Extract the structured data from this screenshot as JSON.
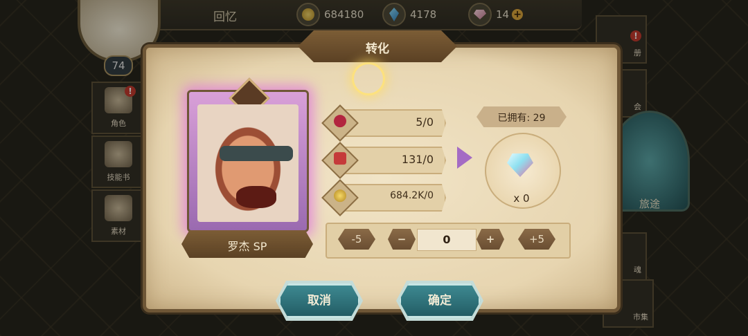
{
  "top_bar": {
    "title": "回忆",
    "coins": "684180",
    "crystals": "4178",
    "gems": "14"
  },
  "player": {
    "level": "74"
  },
  "left_menu": [
    {
      "label": "角色",
      "icon": "character-icon",
      "alert": "!"
    },
    {
      "label": "技能书",
      "icon": "skill-book-icon"
    },
    {
      "label": "素材",
      "icon": "material-icon"
    }
  ],
  "right_menu": {
    "top_partial": "册",
    "second_partial": "会",
    "journey": "旅途",
    "fourth_partial": "魂",
    "market": "市集"
  },
  "dialog": {
    "title": "转化",
    "hero_name": "罗杰 SP",
    "requirements": [
      {
        "icon": "lips-token-icon",
        "value": "5/0"
      },
      {
        "icon": "trophy-potion-icon",
        "value": "131/0"
      },
      {
        "icon": "gold-coin-icon",
        "value": "684.2K/0"
      }
    ],
    "owned": "已拥有: 29",
    "reward_quantity": "x 0",
    "stepper": {
      "minus5": "-5",
      "minus": "−",
      "value": "0",
      "plus": "+",
      "plus5": "+5"
    },
    "cancel": "取消",
    "confirm": "确定"
  },
  "colors": {
    "panel": "#e7d5b0",
    "frame": "#6e5636",
    "button": "#2f7780",
    "accent_purple": "#a46bc4"
  }
}
